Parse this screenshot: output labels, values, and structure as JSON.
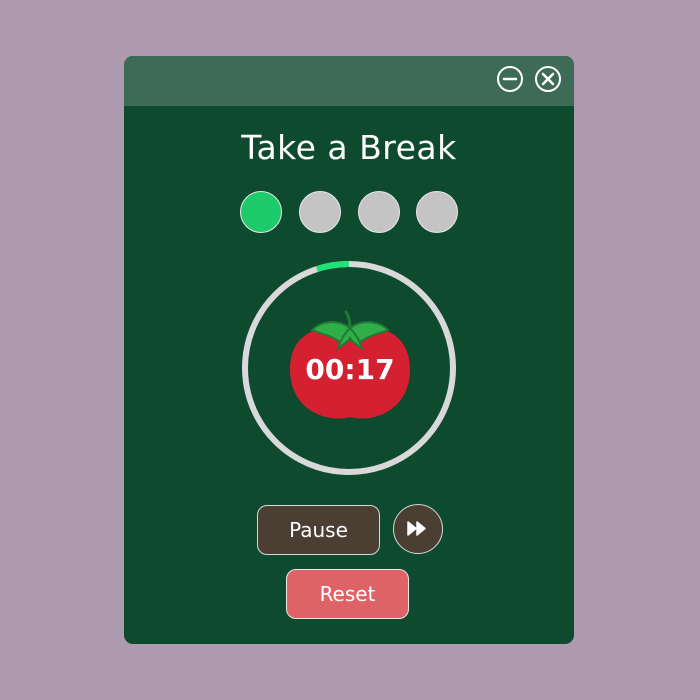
{
  "window": {
    "title": "Take a Break",
    "controls": {
      "minimize_icon": "minus-circle-icon",
      "close_icon": "x-circle-icon"
    }
  },
  "sessions": {
    "total": 4,
    "completed": 1,
    "active_color": "#1ecb6b",
    "inactive_color": "#c4c4c4"
  },
  "timer": {
    "display": "00:17",
    "progress": 0.05,
    "track_color": "#d9d9d9",
    "progress_color": "#1ee37a",
    "icon": "tomato-icon"
  },
  "buttons": {
    "pause_label": "Pause",
    "skip_icon": "fast-forward-icon",
    "reset_label": "Reset"
  },
  "colors": {
    "background": "#ae9aae",
    "window": "#0d4a2e",
    "titlebar": "#3d6b58",
    "tomato": "#d42030",
    "pause_button": "#4a3f32",
    "reset_button": "#df6366"
  }
}
